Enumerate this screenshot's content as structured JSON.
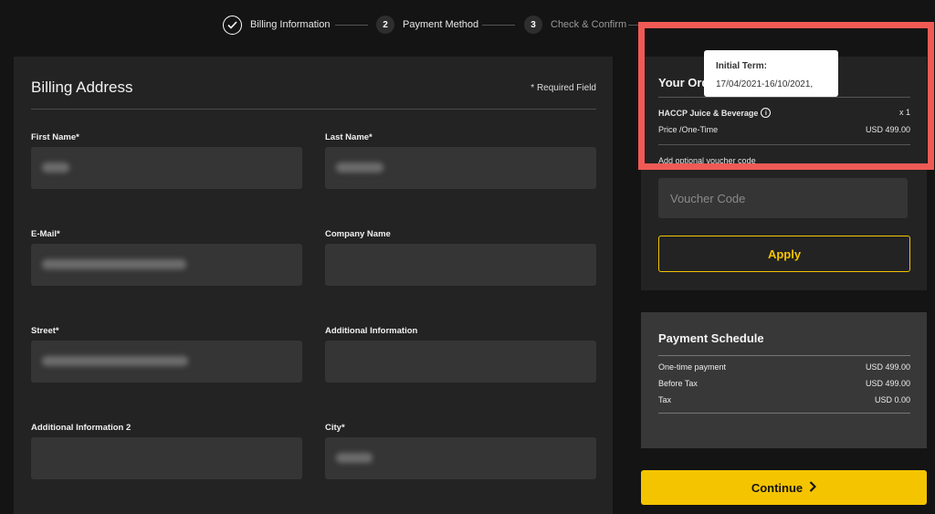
{
  "stepper": {
    "steps": [
      {
        "number": "",
        "label": "Billing Information",
        "status": "completed"
      },
      {
        "number": "2",
        "label": "Payment Method",
        "status": "active"
      },
      {
        "number": "3",
        "label": "Check & Confirm",
        "status": "upcoming"
      }
    ]
  },
  "billing": {
    "title": "Billing Address",
    "required_note": "* Required Field",
    "fields": {
      "first_name": {
        "label": "First Name*"
      },
      "last_name": {
        "label": "Last Name*"
      },
      "email": {
        "label": "E-Mail*"
      },
      "company": {
        "label": "Company Name"
      },
      "street": {
        "label": "Street*"
      },
      "additional_info": {
        "label": "Additional Information"
      },
      "additional_info_2": {
        "label": "Additional Information 2"
      },
      "city": {
        "label": "City*"
      }
    }
  },
  "order": {
    "title": "Your Ord",
    "product_name": "HACCP Juice & Beverage",
    "quantity": "x 1",
    "price_label": "Price /One-Time",
    "price_value": "USD 499.00",
    "voucher_label": "Add optional voucher code",
    "voucher_placeholder": "Voucher Code",
    "apply_label": "Apply"
  },
  "tooltip": {
    "title": "Initial Term:",
    "value": "17/04/2021-16/10/2021,"
  },
  "schedule": {
    "title": "Payment Schedule",
    "rows": [
      {
        "label": "One-time payment",
        "value": "USD  499.00"
      },
      {
        "label": "Before Tax",
        "value": "USD 499.00"
      },
      {
        "label": "Tax",
        "value": "USD 0.00"
      }
    ]
  },
  "continue_label": "Continue",
  "colors": {
    "accent": "#f5c400",
    "highlight": "#f05a55",
    "panel": "#232323",
    "background": "#141414"
  }
}
